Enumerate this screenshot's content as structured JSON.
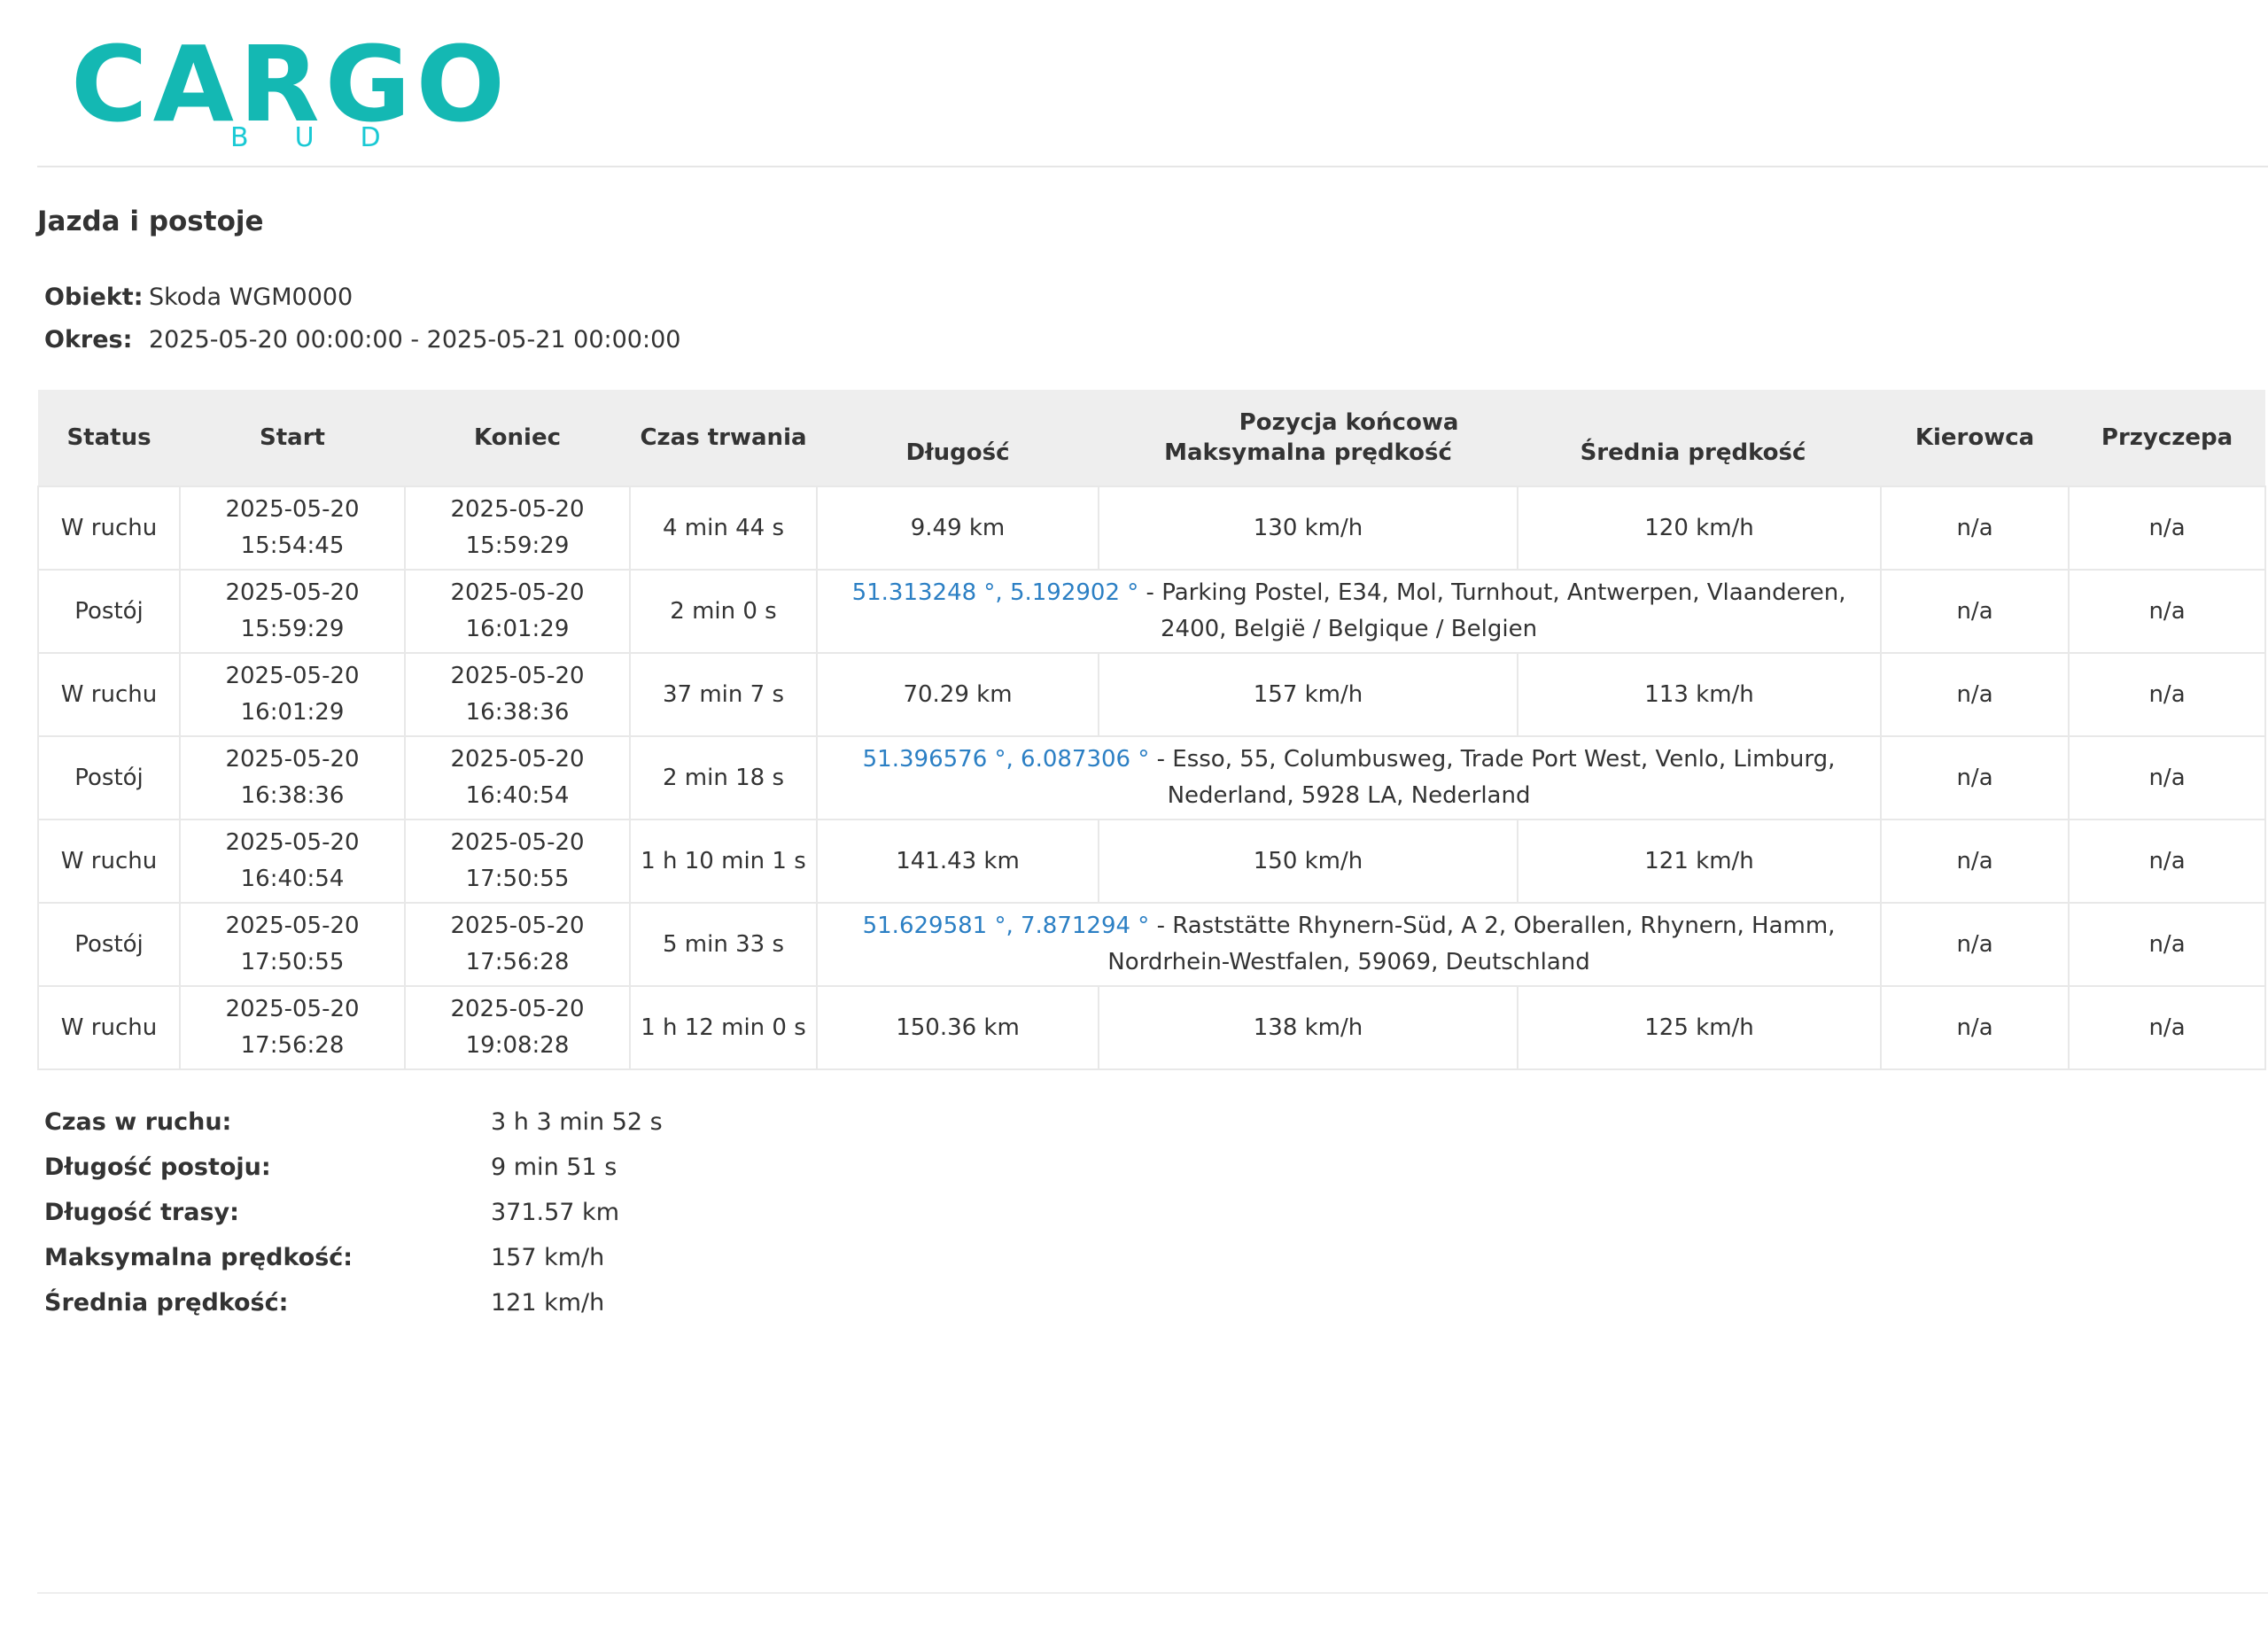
{
  "logo": {
    "word": "CARGO",
    "sub": "BUD",
    "color": "#14b8b3"
  },
  "report": {
    "title": "Jazda i postoje",
    "object_label": "Obiekt:",
    "object_value": "Skoda WGM0000",
    "period_label": "Okres:",
    "period_value": "2025-05-20 00:00:00 - 2025-05-21 00:00:00"
  },
  "table": {
    "headers": {
      "status": "Status",
      "start": "Start",
      "end": "Koniec",
      "duration": "Czas trwania",
      "group": "Pozycja końcowa",
      "length": "Długość",
      "max_speed": "Maksymalna prędkość",
      "avg_speed": "Średnia prędkość",
      "driver": "Kierowca",
      "trailer": "Przyczepa"
    },
    "rows": [
      {
        "status": "W ruchu",
        "start_date": "2025-05-20",
        "start_time": "15:54:45",
        "end_date": "2025-05-20",
        "end_time": "15:59:29",
        "duration": "4 min 44 s",
        "length": "9.49 km",
        "max_speed": "130 km/h",
        "avg_speed": "120 km/h",
        "driver": "n/a",
        "trailer": "n/a"
      },
      {
        "status": "Postój",
        "start_date": "2025-05-20",
        "start_time": "15:59:29",
        "end_date": "2025-05-20",
        "end_time": "16:01:29",
        "duration": "2 min 0 s",
        "coords": "51.313248 °, 5.192902 °",
        "address_1": " - Parking Postel, E34, Mol, Turnhout, Antwerpen, Vlaanderen,",
        "address_2": "2400, België / Belgique / Belgien",
        "driver": "n/a",
        "trailer": "n/a"
      },
      {
        "status": "W ruchu",
        "start_date": "2025-05-20",
        "start_time": "16:01:29",
        "end_date": "2025-05-20",
        "end_time": "16:38:36",
        "duration": "37 min 7 s",
        "length": "70.29 km",
        "max_speed": "157 km/h",
        "avg_speed": "113 km/h",
        "driver": "n/a",
        "trailer": "n/a"
      },
      {
        "status": "Postój",
        "start_date": "2025-05-20",
        "start_time": "16:38:36",
        "end_date": "2025-05-20",
        "end_time": "16:40:54",
        "duration": "2 min 18 s",
        "coords": "51.396576 °, 6.087306 °",
        "address_1": " - Esso, 55, Columbusweg, Trade Port West, Venlo, Limburg,",
        "address_2": "Nederland, 5928 LA, Nederland",
        "driver": "n/a",
        "trailer": "n/a"
      },
      {
        "status": "W ruchu",
        "start_date": "2025-05-20",
        "start_time": "16:40:54",
        "end_date": "2025-05-20",
        "end_time": "17:50:55",
        "duration": "1 h 10 min 1 s",
        "length": "141.43 km",
        "max_speed": "150 km/h",
        "avg_speed": "121 km/h",
        "driver": "n/a",
        "trailer": "n/a"
      },
      {
        "status": "Postój",
        "start_date": "2025-05-20",
        "start_time": "17:50:55",
        "end_date": "2025-05-20",
        "end_time": "17:56:28",
        "duration": "5 min 33 s",
        "coords": "51.629581 °, 7.871294 °",
        "address_1": " - Raststätte Rhynern-Süd, A 2, Oberallen, Rhynern, Hamm,",
        "address_2": "Nordrhein-Westfalen, 59069, Deutschland",
        "driver": "n/a",
        "trailer": "n/a"
      },
      {
        "status": "W ruchu",
        "start_date": "2025-05-20",
        "start_time": "17:56:28",
        "end_date": "2025-05-20",
        "end_time": "19:08:28",
        "duration": "1 h 12 min 0 s",
        "length": "150.36 km",
        "max_speed": "138 km/h",
        "avg_speed": "125 km/h",
        "driver": "n/a",
        "trailer": "n/a"
      }
    ]
  },
  "summary": [
    {
      "label": "Czas w ruchu:",
      "value": "3 h 3 min 52 s"
    },
    {
      "label": "Długość postoju:",
      "value": "9 min 51 s"
    },
    {
      "label": "Długość trasy:",
      "value": "371.57 km"
    },
    {
      "label": "Maksymalna prędkość:",
      "value": "157 km/h"
    },
    {
      "label": "Średnia prędkość:",
      "value": "121 km/h"
    }
  ],
  "colors": {
    "link": "#2b7fc4",
    "header_bg": "#eeeeee",
    "border": "#e8e8e8"
  }
}
